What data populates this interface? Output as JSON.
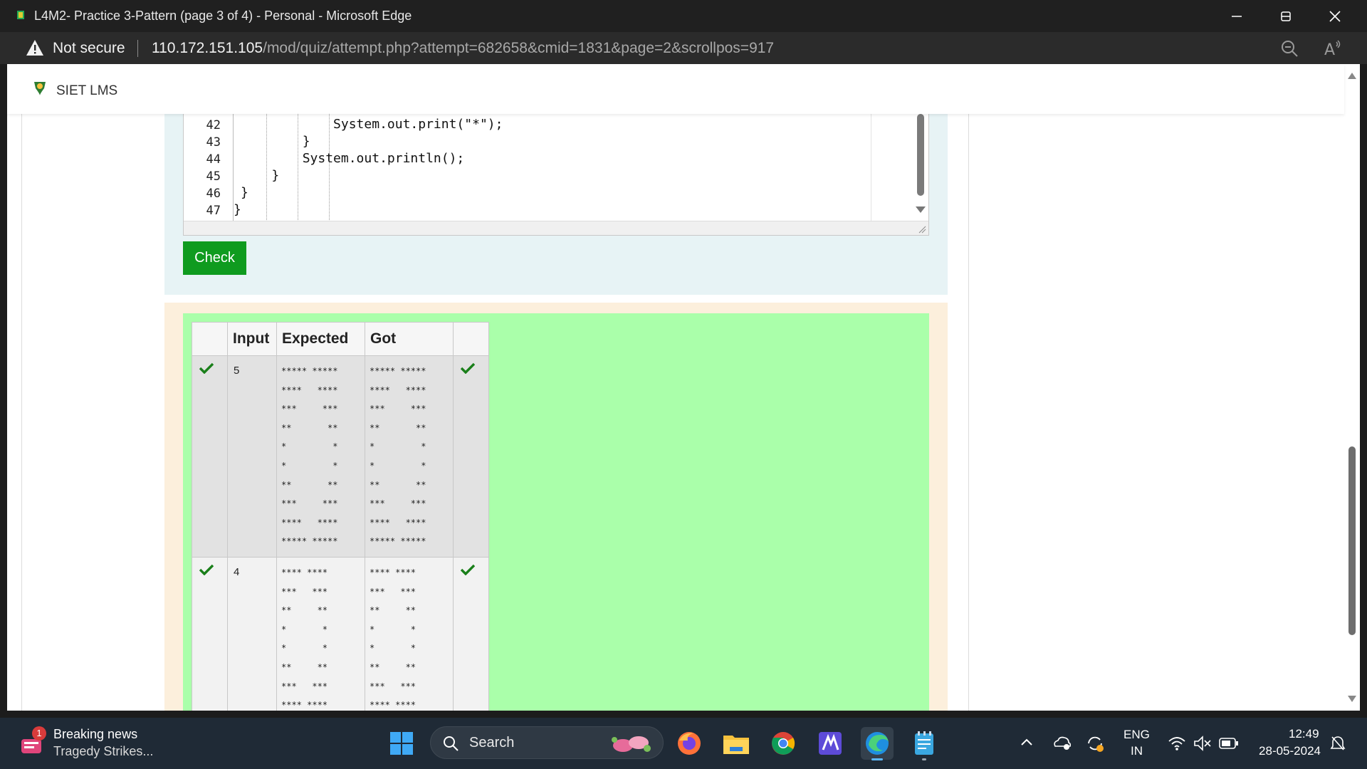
{
  "window": {
    "title": "L4M2- Practice 3-Pattern (page 3 of 4) - Personal - Microsoft Edge"
  },
  "addressbar": {
    "security_label": "Not secure",
    "url_host": "110.172.151.105",
    "url_path": "/mod/quiz/attempt.php?attempt=682658&cmid=1831&page=2&scrollpos=917"
  },
  "site": {
    "name": "SIET LMS"
  },
  "code": {
    "lines": [
      {
        "num": "42",
        "text": "            System.out.print(\"*\");"
      },
      {
        "num": "43",
        "text": "        }"
      },
      {
        "num": "44",
        "text": "        System.out.println();"
      },
      {
        "num": "45",
        "text": "    }"
      },
      {
        "num": "46",
        "text": "}"
      },
      {
        "num": "47",
        "text": "}"
      }
    ],
    "check_label": "Check"
  },
  "results": {
    "headers": [
      "",
      "Input",
      "Expected",
      "Got",
      ""
    ],
    "rows": [
      {
        "input": "5",
        "expected": [
          "***** *****",
          "****   ****",
          "***     ***",
          "**       **",
          "*         *",
          "*         *",
          "**       **",
          "***     ***",
          "****   ****",
          "***** *****"
        ],
        "got": [
          "***** *****",
          "****   ****",
          "***     ***",
          "**       **",
          "*         *",
          "*         *",
          "**       **",
          "***     ***",
          "****   ****",
          "***** *****"
        ]
      },
      {
        "input": "4",
        "expected": [
          "**** ****",
          "***   ***",
          "**     **",
          "*       *",
          "*       *",
          "**     **",
          "***   ***",
          "**** ****"
        ],
        "got": [
          "**** ****",
          "***   ***",
          "**     **",
          "*       *",
          "*       *",
          "**     **",
          "***   ***",
          "**** ****"
        ]
      }
    ]
  },
  "taskbar": {
    "news_badge": "1",
    "news_title": "Breaking news",
    "news_subtitle": "Tragedy Strikes...",
    "search_label": "Search",
    "lang_top": "ENG",
    "lang_bottom": "IN",
    "time": "12:49",
    "date": "28-05-2024"
  },
  "colors": {
    "check_button": "#0f9b1f",
    "result_green": "#aaffaa",
    "question_panel": "#e7f3f5",
    "result_panel": "#fcefdc",
    "tick": "#1a7f1a"
  },
  "icons": {
    "titlebar": [
      "minimize-icon",
      "maximize-icon",
      "close-icon"
    ],
    "addressbar": [
      "warning-icon",
      "zoom-icon",
      "read-aloud-icon"
    ],
    "taskbar": [
      "windows-start-icon",
      "search-icon",
      "firefox-icon",
      "file-explorer-icon",
      "chrome-icon",
      "visual-studio-icon",
      "edge-icon",
      "notepad-icon"
    ],
    "tray": [
      "chevron-up-icon",
      "onedrive-icon",
      "sync-icon",
      "wifi-icon",
      "mute-icon",
      "battery-icon",
      "notification-icon"
    ]
  }
}
